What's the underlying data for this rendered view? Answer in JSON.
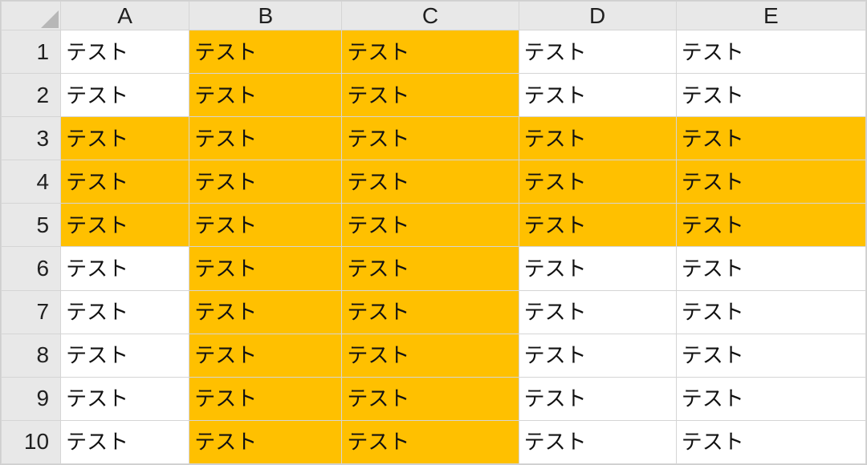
{
  "columns": [
    "A",
    "B",
    "C",
    "D",
    "E"
  ],
  "rowNumbers": [
    "1",
    "2",
    "3",
    "4",
    "5",
    "6",
    "7",
    "8",
    "9",
    "10"
  ],
  "cellText": "テスト",
  "highlightColor": "#ffc000",
  "highlight": {
    "rows": [
      3,
      4,
      5
    ],
    "cols": [
      "B",
      "C"
    ]
  },
  "grid": [
    [
      {
        "col": "A",
        "t": "テスト",
        "hi": false
      },
      {
        "col": "B",
        "t": "テスト",
        "hi": true
      },
      {
        "col": "C",
        "t": "テスト",
        "hi": true
      },
      {
        "col": "D",
        "t": "テスト",
        "hi": false
      },
      {
        "col": "E",
        "t": "テスト",
        "hi": false
      }
    ],
    [
      {
        "col": "A",
        "t": "テスト",
        "hi": false
      },
      {
        "col": "B",
        "t": "テスト",
        "hi": true
      },
      {
        "col": "C",
        "t": "テスト",
        "hi": true
      },
      {
        "col": "D",
        "t": "テスト",
        "hi": false
      },
      {
        "col": "E",
        "t": "テスト",
        "hi": false
      }
    ],
    [
      {
        "col": "A",
        "t": "テスト",
        "hi": true
      },
      {
        "col": "B",
        "t": "テスト",
        "hi": true
      },
      {
        "col": "C",
        "t": "テスト",
        "hi": true
      },
      {
        "col": "D",
        "t": "テスト",
        "hi": true
      },
      {
        "col": "E",
        "t": "テスト",
        "hi": true
      }
    ],
    [
      {
        "col": "A",
        "t": "テスト",
        "hi": true
      },
      {
        "col": "B",
        "t": "テスト",
        "hi": true
      },
      {
        "col": "C",
        "t": "テスト",
        "hi": true
      },
      {
        "col": "D",
        "t": "テスト",
        "hi": true
      },
      {
        "col": "E",
        "t": "テスト",
        "hi": true
      }
    ],
    [
      {
        "col": "A",
        "t": "テスト",
        "hi": true
      },
      {
        "col": "B",
        "t": "テスト",
        "hi": true
      },
      {
        "col": "C",
        "t": "テスト",
        "hi": true
      },
      {
        "col": "D",
        "t": "テスト",
        "hi": true
      },
      {
        "col": "E",
        "t": "テスト",
        "hi": true
      }
    ],
    [
      {
        "col": "A",
        "t": "テスト",
        "hi": false
      },
      {
        "col": "B",
        "t": "テスト",
        "hi": true
      },
      {
        "col": "C",
        "t": "テスト",
        "hi": true
      },
      {
        "col": "D",
        "t": "テスト",
        "hi": false
      },
      {
        "col": "E",
        "t": "テスト",
        "hi": false
      }
    ],
    [
      {
        "col": "A",
        "t": "テスト",
        "hi": false
      },
      {
        "col": "B",
        "t": "テスト",
        "hi": true
      },
      {
        "col": "C",
        "t": "テスト",
        "hi": true
      },
      {
        "col": "D",
        "t": "テスト",
        "hi": false
      },
      {
        "col": "E",
        "t": "テスト",
        "hi": false
      }
    ],
    [
      {
        "col": "A",
        "t": "テスト",
        "hi": false
      },
      {
        "col": "B",
        "t": "テスト",
        "hi": true
      },
      {
        "col": "C",
        "t": "テスト",
        "hi": true
      },
      {
        "col": "D",
        "t": "テスト",
        "hi": false
      },
      {
        "col": "E",
        "t": "テスト",
        "hi": false
      }
    ],
    [
      {
        "col": "A",
        "t": "テスト",
        "hi": false
      },
      {
        "col": "B",
        "t": "テスト",
        "hi": true
      },
      {
        "col": "C",
        "t": "テスト",
        "hi": true
      },
      {
        "col": "D",
        "t": "テスト",
        "hi": false
      },
      {
        "col": "E",
        "t": "テスト",
        "hi": false
      }
    ],
    [
      {
        "col": "A",
        "t": "テスト",
        "hi": false
      },
      {
        "col": "B",
        "t": "テスト",
        "hi": true
      },
      {
        "col": "C",
        "t": "テスト",
        "hi": true
      },
      {
        "col": "D",
        "t": "テスト",
        "hi": false
      },
      {
        "col": "E",
        "t": "テスト",
        "hi": false
      }
    ]
  ]
}
